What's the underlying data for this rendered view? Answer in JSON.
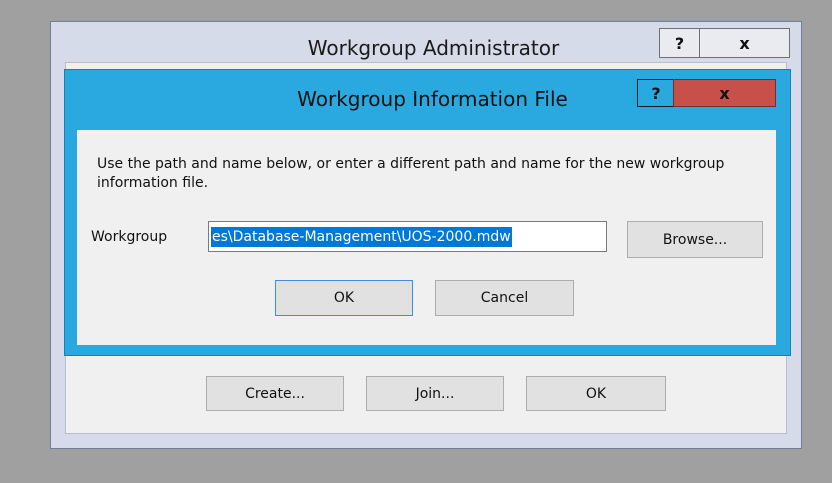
{
  "outer_dialog": {
    "title": "Workgroup Administrator",
    "help_label": "?",
    "close_label": "x",
    "buttons": {
      "create": "Create...",
      "join": "Join...",
      "ok": "OK"
    }
  },
  "inner_dialog": {
    "title": "Workgroup Information File",
    "help_label": "?",
    "close_label": "x",
    "prompt_text": "Use the path and name below, or enter a different path and name for the new workgroup information file.",
    "workgroup_label": "Workgroup",
    "workgroup_value": "es\\Database-Management\\UOS-2000.mdw",
    "browse_label": "Browse...",
    "ok_label": "OK",
    "cancel_label": "Cancel"
  }
}
